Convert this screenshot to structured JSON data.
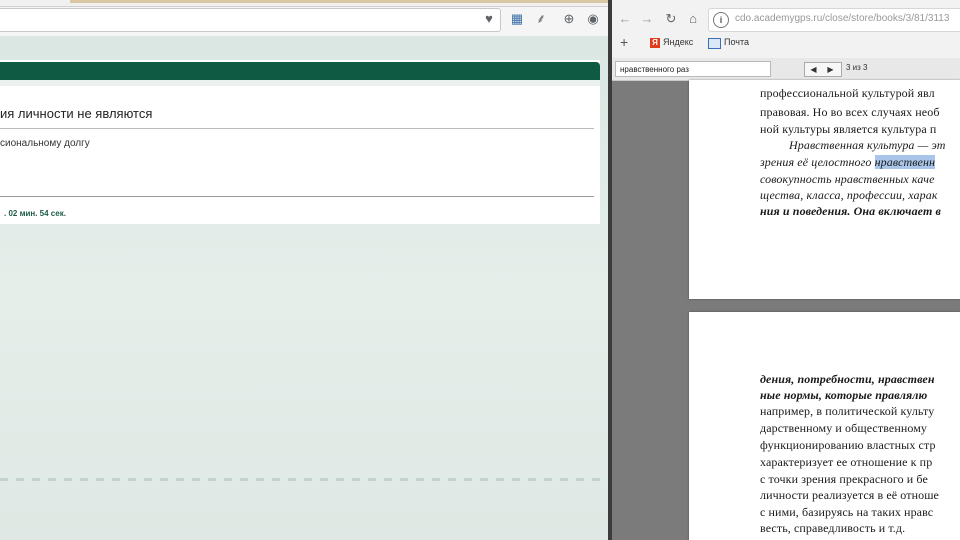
{
  "left_window": {
    "question_title": "ия личности не являются",
    "answer_option": "сиональному долгу",
    "timer_text": ". 02 мин. 54 сек."
  },
  "right_window": {
    "nav": {
      "back": "←",
      "forward": "→",
      "reload": "↻",
      "home": "⌂"
    },
    "address_text": "cdo.academygps.ru/close/store/books/3/81/3113",
    "bookmarks": {
      "add": "+",
      "yandex": "Яндекс",
      "mail": "Почта"
    },
    "find": {
      "query": "нравственного раз",
      "prev": "◀",
      "next": "▶",
      "count": "3 из 3"
    },
    "page1_lines": [
      "профессиональной культурой явл",
      "правовая. Но во всех случаях необ",
      "ной культуры является культура п",
      "Нравственная культура — эт",
      "зрения её целостного ",
      "совокупность нравственных каче",
      "щества, класса, профессии, харак",
      "ния и поведения. Она включает в"
    ],
    "page1_highlight": "нравственн",
    "page2_lines": [
      "дения, потребности, нравствен",
      "ные нормы, которые правлялю",
      "например, в политической культу",
      "дарственному и общественному",
      "функционированию властных стр",
      "характеризует ее отношение к пр",
      "с точки зрения прекрасного и бе",
      "личности реализуется в её отноше",
      "с ними, базируясь на таких нравс",
      "весть, справедливость и т.д."
    ]
  }
}
